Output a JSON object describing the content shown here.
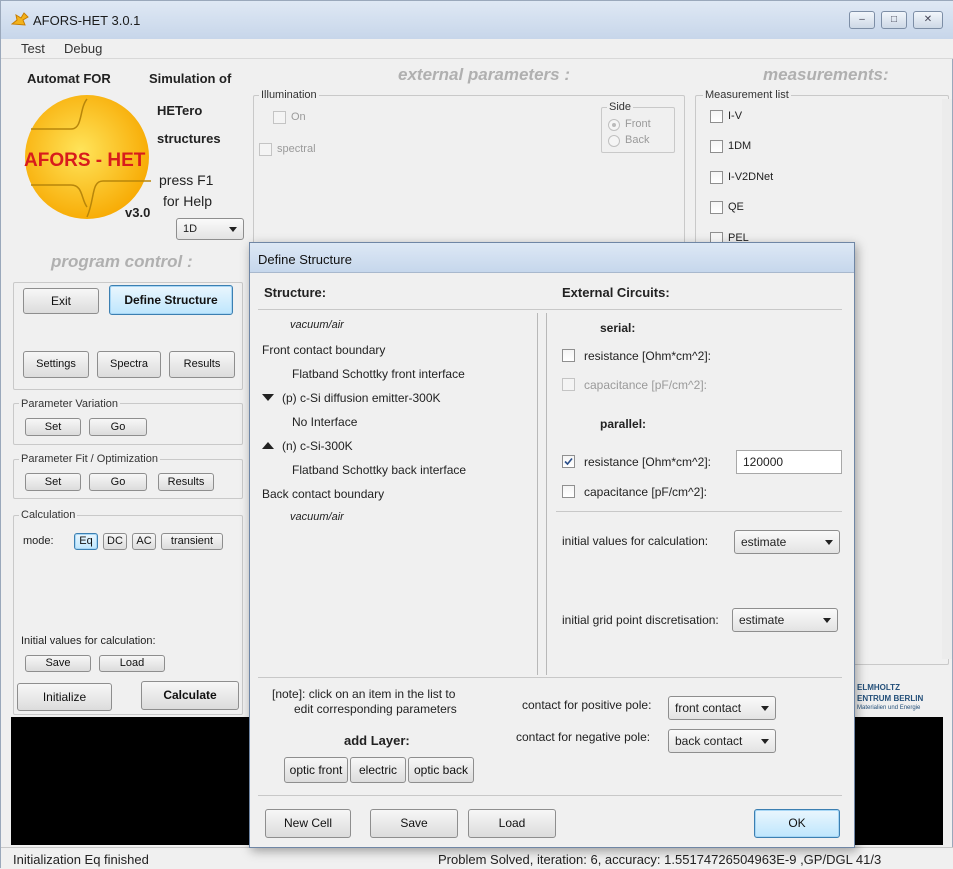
{
  "window": {
    "title": "AFORS-HET 3.0.1"
  },
  "menu": [
    "Test",
    "Debug"
  ],
  "logo": {
    "line1": "Automat  FOR",
    "line2": "Simulation of",
    "line3": "HETero",
    "line4": "structures",
    "name": "AFORS - HET",
    "version": "v3.0",
    "help1": "press F1",
    "help2": "for Help",
    "dimension": "1D"
  },
  "headers": {
    "external": "external parameters :",
    "measurements": "measurements:",
    "program_control": "program control :"
  },
  "illumination": {
    "title": "Illumination",
    "on_label": "On",
    "spectral_label": "spectral",
    "side_title": "Side",
    "front": "Front",
    "back": "Back"
  },
  "measurements": {
    "list_title": "Measurement list",
    "items": [
      "I-V",
      "1DM",
      "I-V2DNet",
      "QE",
      "PEL"
    ]
  },
  "program": {
    "exit": "Exit",
    "define_structure": "Define Structure",
    "settings": "Settings",
    "spectra": "Spectra",
    "results": "Results",
    "param_variation": "Parameter Variation",
    "set": "Set",
    "go": "Go",
    "param_fit": "Parameter Fit / Optimization",
    "calculation": "Calculation",
    "mode_label": "mode:",
    "modes": [
      "Eq",
      "DC",
      "AC",
      "transient"
    ],
    "initial_values": "Initial values for calculation:",
    "save": "Save",
    "load": "Load",
    "initialize": "Initialize",
    "calculate": "Calculate"
  },
  "helmholtz": {
    "line1": "ELMHOLTZ",
    "line2": "ENTRUM BERLIN",
    "line3": "Materialien und Energie"
  },
  "dialog": {
    "title": "Define Structure",
    "structure_header": "Structure:",
    "external_header": "External Circuits:",
    "structure_items": [
      {
        "text": "vacuum/air",
        "style": "italic"
      },
      {
        "text": "Front contact boundary",
        "style": "plain"
      },
      {
        "text": "Flatband Schottky front interface",
        "style": "indent"
      },
      {
        "text": "(p) c-Si diffusion emitter-300K",
        "style": "down"
      },
      {
        "text": "No Interface",
        "style": "indent"
      },
      {
        "text": "(n) c-Si-300K",
        "style": "up"
      },
      {
        "text": "Flatband Schottky back interface",
        "style": "indent"
      },
      {
        "text": "Back contact boundary",
        "style": "plain"
      },
      {
        "text": "vacuum/air",
        "style": "italic"
      }
    ],
    "serial": "serial:",
    "parallel": "parallel:",
    "resistance": "resistance [Ohm*cm^2]:",
    "capacitance": "capacitance [pF/cm^2]:",
    "parallel_resistance_value": "120000",
    "initial_values_label": "initial values for calculation:",
    "initial_values_select": "estimate",
    "grid_label": "initial grid point discretisation:",
    "grid_select": "estimate",
    "note_line1": "[note]: click on an item in the list to",
    "note_line2": "edit corresponding parameters",
    "add_layer": "add Layer:",
    "layer_buttons": [
      "optic front",
      "electric",
      "optic back"
    ],
    "positive_pole_label": "contact for positive pole:",
    "positive_pole_value": "front contact",
    "negative_pole_label": "contact for negative pole:",
    "negative_pole_value": "back contact",
    "new_cell": "New Cell",
    "save": "Save",
    "load": "Load",
    "ok": "OK"
  },
  "status": {
    "left": "Initialization Eq finished",
    "right": "Problem Solved,   iteration: 6,  accuracy: 1.55174726504963E-9 ,GP/DGL 41/3"
  }
}
